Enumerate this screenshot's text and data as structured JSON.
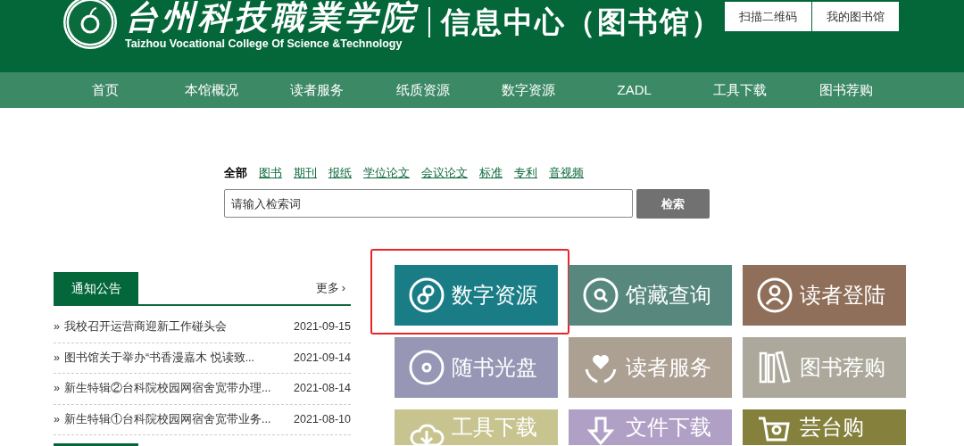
{
  "header": {
    "college_name": "台州科技職業学院",
    "college_name_en": "Taizhou Vocational College Of Science &Technology",
    "site_title": "信息中心（图书馆）",
    "buttons": [
      "扫描二维码",
      "我的图书馆"
    ]
  },
  "nav": [
    {
      "label": "首页"
    },
    {
      "label": "本馆概况"
    },
    {
      "label": "读者服务"
    },
    {
      "label": "纸质资源"
    },
    {
      "label": "数字资源"
    },
    {
      "label": "ZADL"
    },
    {
      "label": "工具下载"
    },
    {
      "label": "图书荐购"
    }
  ],
  "search": {
    "tabs": [
      {
        "label": "全部",
        "selected": true
      },
      {
        "label": "图书",
        "selected": false
      },
      {
        "label": "期刊",
        "selected": false
      },
      {
        "label": "报纸",
        "selected": false
      },
      {
        "label": "学位论文",
        "selected": false
      },
      {
        "label": "会议论文",
        "selected": false
      },
      {
        "label": "标准",
        "selected": false
      },
      {
        "label": "专利",
        "selected": false
      },
      {
        "label": "音视频",
        "selected": false
      }
    ],
    "placeholder": "请输入检索词",
    "button": "检索"
  },
  "notices": {
    "title": "通知公告",
    "more": "更多",
    "more_icon": "›",
    "items": [
      {
        "bullet": "»",
        "title": "我校召开运营商迎新工作碰头会",
        "date": "2021-09-15"
      },
      {
        "bullet": "»",
        "title": "图书馆关于举办“书香漫嘉木 悦读致...",
        "date": "2021-09-14"
      },
      {
        "bullet": "»",
        "title": "新生特辑②台科院校园网宿舍宽带办理...",
        "date": "2021-08-14"
      },
      {
        "bullet": "»",
        "title": "新生特辑①台科院校园网宿舍宽带业务...",
        "date": "2021-08-10"
      }
    ]
  },
  "tiles": [
    {
      "label": "数字资源",
      "kind": "digital",
      "color": "#1a7d86",
      "highlighted": true
    },
    {
      "label": "馆藏查询",
      "kind": "search",
      "color": "#57877d",
      "highlighted": false
    },
    {
      "label": "读者登陆",
      "kind": "user",
      "color": "#8f6f5a",
      "highlighted": false
    },
    {
      "label": "随书光盘",
      "kind": "disc",
      "color": "#9796b4",
      "highlighted": false
    },
    {
      "label": "读者服务",
      "kind": "heart",
      "color": "#aca093",
      "highlighted": false
    },
    {
      "label": "图书荐购",
      "kind": "books",
      "color": "#aca99c",
      "highlighted": false
    },
    {
      "label": "工具下载",
      "kind": "cloud",
      "color": "#c8c490",
      "highlighted": false
    },
    {
      "label": "文件下载",
      "kind": "download",
      "color": "#b1a0c6",
      "highlighted": false
    },
    {
      "label": "芸台购",
      "kind": "cart",
      "color": "#85813d",
      "highlighted": false
    }
  ]
}
